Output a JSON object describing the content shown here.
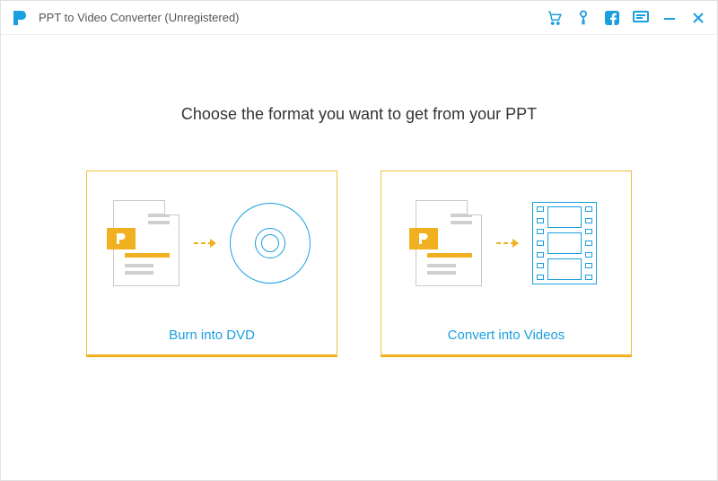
{
  "window": {
    "title": "PPT to Video Converter (Unregistered)"
  },
  "headline": "Choose the format you want to get from your PPT",
  "options": {
    "dvd": {
      "label": "Burn into DVD"
    },
    "video": {
      "label": "Convert into Videos"
    }
  },
  "colors": {
    "accent_blue": "#1a9fe0",
    "accent_yellow": "#f0b020"
  }
}
